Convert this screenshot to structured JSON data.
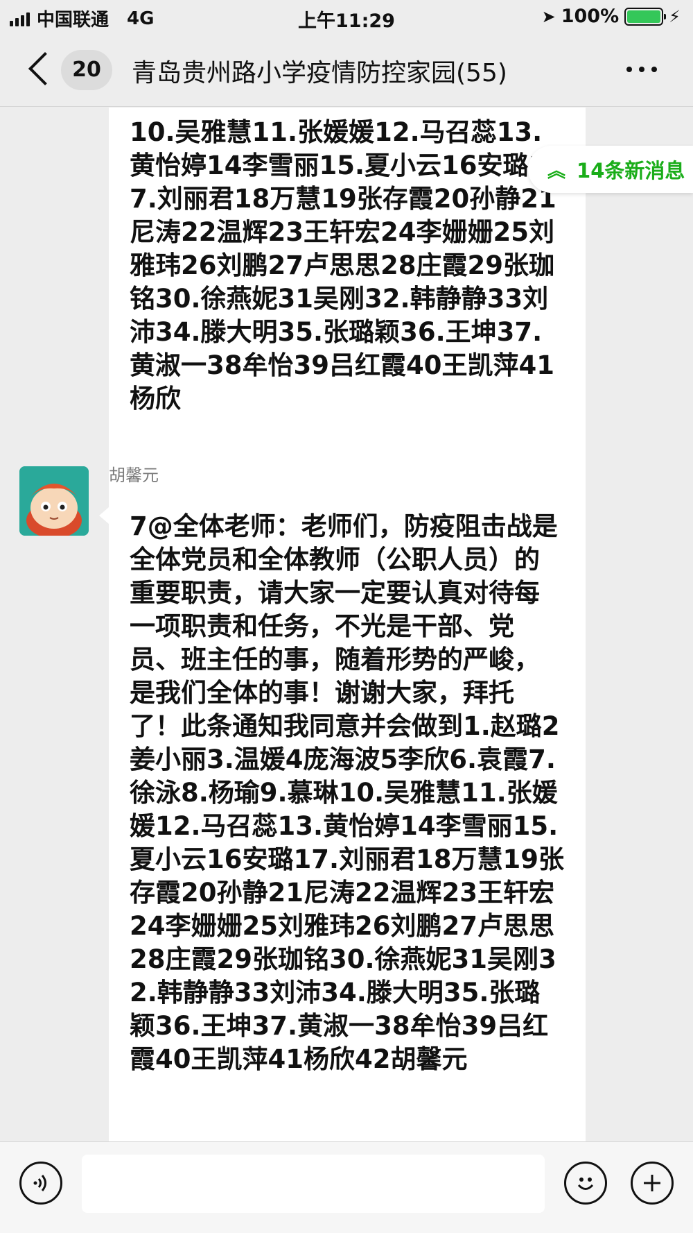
{
  "status_bar": {
    "carrier": "中国联通",
    "network": "4G",
    "time": "上午11:29",
    "battery": "100%",
    "battery_level": 1.0
  },
  "nav": {
    "unread_count": "20",
    "title": "青岛贵州路小学疫情防控家园(55)"
  },
  "new_messages": {
    "label": "14条新消息"
  },
  "messages": [
    {
      "text": "10.吴雅慧11.张媛媛12.马召蕊13.黄怡婷14李雪丽15.夏小云16安璐17.刘丽君18万慧19张存霞20孙静21尼涛22温辉23王轩宏24李姗姗25刘雅玮26刘鹏27卢思思28庄霞29张珈铭30.徐燕妮31吴刚32.韩静静33刘沛34.滕大明35.张璐颖36.王坤37.黄淑一38牟怡39吕红霞40王凯萍41杨欣"
    },
    {
      "sender": "胡馨元",
      "text": "7@全体老师：老师们，防疫阻击战是全体党员和全体教师（公职人员）的重要职责，请大家一定要认真对待每一项职责和任务，不光是干部、党员、班主任的事，随着形势的严峻，是我们全体的事！谢谢大家，拜托了！此条通知我同意并会做到1.赵璐2姜小丽3.温媛4庞海波5李欣6.袁霞7.徐泳8.杨瑜9.慕琳10.吴雅慧11.张媛媛12.马召蕊13.黄怡婷14李雪丽15.夏小云16安璐17.刘丽君18万慧19张存霞20孙静21尼涛22温辉23王轩宏24李姗姗25刘雅玮26刘鹏27卢思思28庄霞29张珈铭30.徐燕妮31吴刚32.韩静静33刘沛34.滕大明35.张璐颖36.王坤37.黄淑一38牟怡39吕红霞40王凯萍41杨欣42胡馨元"
    }
  ]
}
